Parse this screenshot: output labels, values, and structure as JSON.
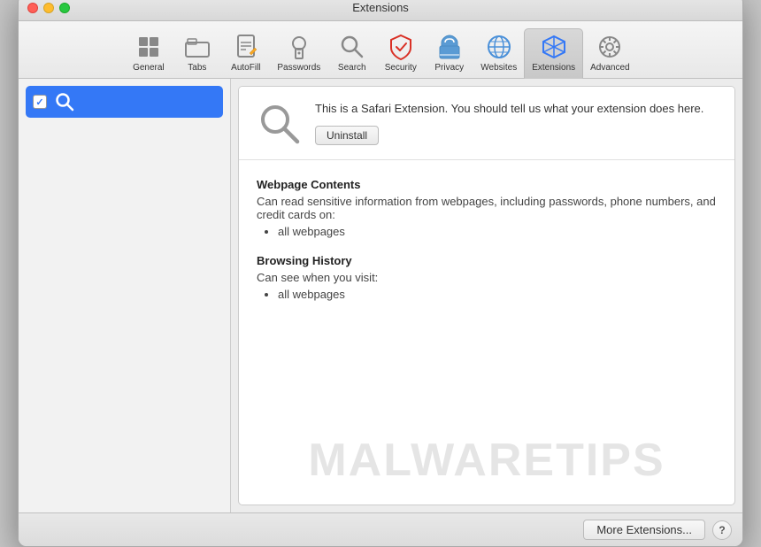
{
  "window": {
    "title": "Extensions"
  },
  "toolbar": {
    "items": [
      {
        "id": "general",
        "label": "General",
        "icon": "⊞"
      },
      {
        "id": "tabs",
        "label": "Tabs",
        "icon": "⬜"
      },
      {
        "id": "autofill",
        "label": "AutoFill",
        "icon": "✏️"
      },
      {
        "id": "passwords",
        "label": "Passwords",
        "icon": "🔑"
      },
      {
        "id": "search",
        "label": "Search",
        "icon": "🔍"
      },
      {
        "id": "security",
        "label": "Security",
        "icon": "🛡️"
      },
      {
        "id": "privacy",
        "label": "Privacy",
        "icon": "✋"
      },
      {
        "id": "websites",
        "label": "Websites",
        "icon": "🌐"
      },
      {
        "id": "extensions",
        "label": "Extensions",
        "icon": "⚡"
      },
      {
        "id": "advanced",
        "label": "Advanced",
        "icon": "⚙️"
      }
    ]
  },
  "sidebar": {
    "items": [
      {
        "id": "search-ext",
        "label": "",
        "checked": true
      }
    ]
  },
  "extension": {
    "description": "This is a Safari Extension. You should tell us what your extension does here.",
    "uninstall_label": "Uninstall",
    "permissions": [
      {
        "title": "Webpage Contents",
        "desc": "Can read sensitive information from webpages, including passwords, phone numbers, and credit cards on:",
        "items": [
          "all webpages"
        ]
      },
      {
        "title": "Browsing History",
        "desc": "Can see when you visit:",
        "items": [
          "all webpages"
        ]
      }
    ]
  },
  "footer": {
    "more_extensions_label": "More Extensions...",
    "help_label": "?"
  },
  "watermark": {
    "text": "MALWARETIPS"
  },
  "traffic_lights": {
    "close_title": "Close",
    "minimize_title": "Minimize",
    "maximize_title": "Maximize"
  }
}
